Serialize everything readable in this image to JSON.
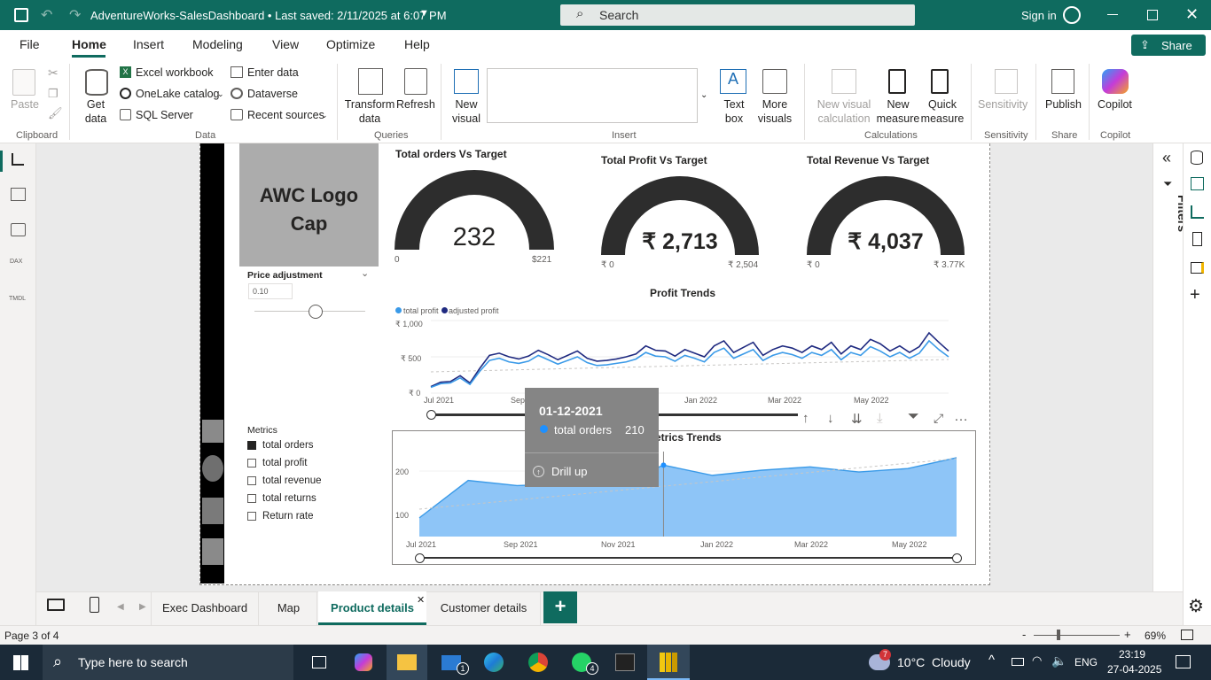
{
  "window": {
    "title": "AdventureWorks-SalesDashboard • Last saved: 2/11/2025 at 6:07 PM",
    "search_placeholder": "Search",
    "sign_in": "Sign in"
  },
  "menu": {
    "items": [
      "File",
      "Home",
      "Insert",
      "Modeling",
      "View",
      "Optimize",
      "Help"
    ],
    "active": "Home",
    "share": "Share"
  },
  "ribbon": {
    "clipboard": {
      "paste": "Paste",
      "group": "Clipboard"
    },
    "data": {
      "get_data": "Get data",
      "excel": "Excel workbook",
      "onelake": "OneLake catalog",
      "sql": "SQL Server",
      "enter_data": "Enter data",
      "dataverse": "Dataverse",
      "recent": "Recent sources",
      "group": "Data"
    },
    "queries": {
      "transform": "Transform data",
      "refresh": "Refresh",
      "group": "Queries"
    },
    "insert": {
      "new_visual": "New visual",
      "text_box": "Text box",
      "more_visuals": "More visuals",
      "group": "Insert"
    },
    "calculations": {
      "new_visual_calc": "New visual calculation",
      "new_measure": "New measure",
      "quick_measure": "Quick measure",
      "group": "Calculations"
    },
    "sensitivity": {
      "label": "Sensitivity",
      "group": "Sensitivity"
    },
    "share": {
      "publish": "Publish",
      "group": "Share"
    },
    "copilot": {
      "label": "Copilot",
      "group": "Copilot"
    }
  },
  "report": {
    "logo_text": "AWC Logo Cap",
    "price_adjustment": {
      "label": "Price adjustment",
      "value": "0.10",
      "slider_fraction": 0.55
    },
    "gauges": [
      {
        "title": "Total orders Vs Target",
        "value": "232",
        "min": "0",
        "max": "$221",
        "fill_fraction": 1.0
      },
      {
        "title": "Total Profit Vs Target",
        "value": "₹ 2,713",
        "min": "₹ 0",
        "max": "₹ 2,504",
        "fill_fraction": 1.0
      },
      {
        "title": "Total Revenue Vs Target",
        "value": "₹ 4,037",
        "min": "₹ 0",
        "max": "₹ 3.77K",
        "fill_fraction": 1.0
      }
    ],
    "metrics": {
      "title": "Metrics",
      "items": [
        {
          "label": "total orders",
          "checked": true
        },
        {
          "label": "total profit",
          "checked": false
        },
        {
          "label": "total revenue",
          "checked": false
        },
        {
          "label": "total returns",
          "checked": false
        },
        {
          "label": "Return rate",
          "checked": false
        }
      ]
    },
    "tooltip": {
      "date": "01-12-2021",
      "series": "total orders",
      "value": "210",
      "action": "Drill up"
    },
    "filters_label": "Filters"
  },
  "chart_data": [
    {
      "type": "line",
      "title": "Profit Trends",
      "legend": [
        "total profit",
        "adjusted profit"
      ],
      "legend_placement": "top-left",
      "colors": {
        "total profit": "#3a9ae8",
        "adjusted profit": "#1f2a80"
      },
      "yticks": [
        "₹ 1,000",
        "₹ 500",
        "₹ 0"
      ],
      "ylim": [
        0,
        1000
      ],
      "xticks": [
        "Jul 2021",
        "Sep",
        "Jan 2022",
        "Mar 2022",
        "May 2022"
      ],
      "series": [
        {
          "name": "total profit",
          "values": [
            80,
            130,
            140,
            210,
            120,
            300,
            450,
            480,
            430,
            410,
            440,
            520,
            460,
            400,
            450,
            500,
            420,
            380,
            390,
            410,
            430,
            470,
            560,
            510,
            500,
            440,
            520,
            480,
            430,
            560,
            620,
            480,
            540,
            600,
            450,
            520,
            560,
            530,
            480,
            560,
            520,
            600,
            460,
            560,
            520,
            640,
            580,
            500,
            560,
            480,
            550,
            720,
            600,
            500
          ]
        },
        {
          "name": "adjusted profit",
          "values": [
            90,
            150,
            160,
            240,
            140,
            340,
            520,
            550,
            500,
            470,
            510,
            590,
            530,
            460,
            520,
            580,
            480,
            440,
            450,
            470,
            500,
            540,
            650,
            590,
            580,
            510,
            600,
            550,
            500,
            650,
            720,
            560,
            630,
            700,
            520,
            600,
            650,
            620,
            560,
            650,
            600,
            700,
            540,
            650,
            600,
            740,
            680,
            580,
            650,
            560,
            640,
            830,
            700,
            580
          ]
        }
      ]
    },
    {
      "type": "area",
      "title": "Metrics Trends",
      "colors": {
        "total orders": "#8ec5f7"
      },
      "yticks": [
        "200",
        "100"
      ],
      "xticks": [
        "Jul 2021",
        "Sep 2021",
        "Nov 2021",
        "Jan 2022",
        "Mar 2022",
        "May 2022"
      ],
      "series": [
        {
          "name": "total orders",
          "values": [
            55,
            165,
            150,
            155,
            150,
            210,
            180,
            195,
            205,
            190,
            200,
            232
          ]
        }
      ]
    }
  ],
  "pages": {
    "tabs": [
      "Exec Dashboard",
      "Map",
      "Product details",
      "Customer details"
    ],
    "active": "Product details",
    "status": "Page 3 of 4",
    "zoom": "69%"
  },
  "taskbar": {
    "search_placeholder": "Type here to search",
    "weather": "10°C  Cloudy",
    "lang": "ENG",
    "time": "23:19",
    "date": "27-04-2025",
    "mail_badge": "1",
    "whatsapp_badge": "4",
    "notification_badge": "7"
  }
}
